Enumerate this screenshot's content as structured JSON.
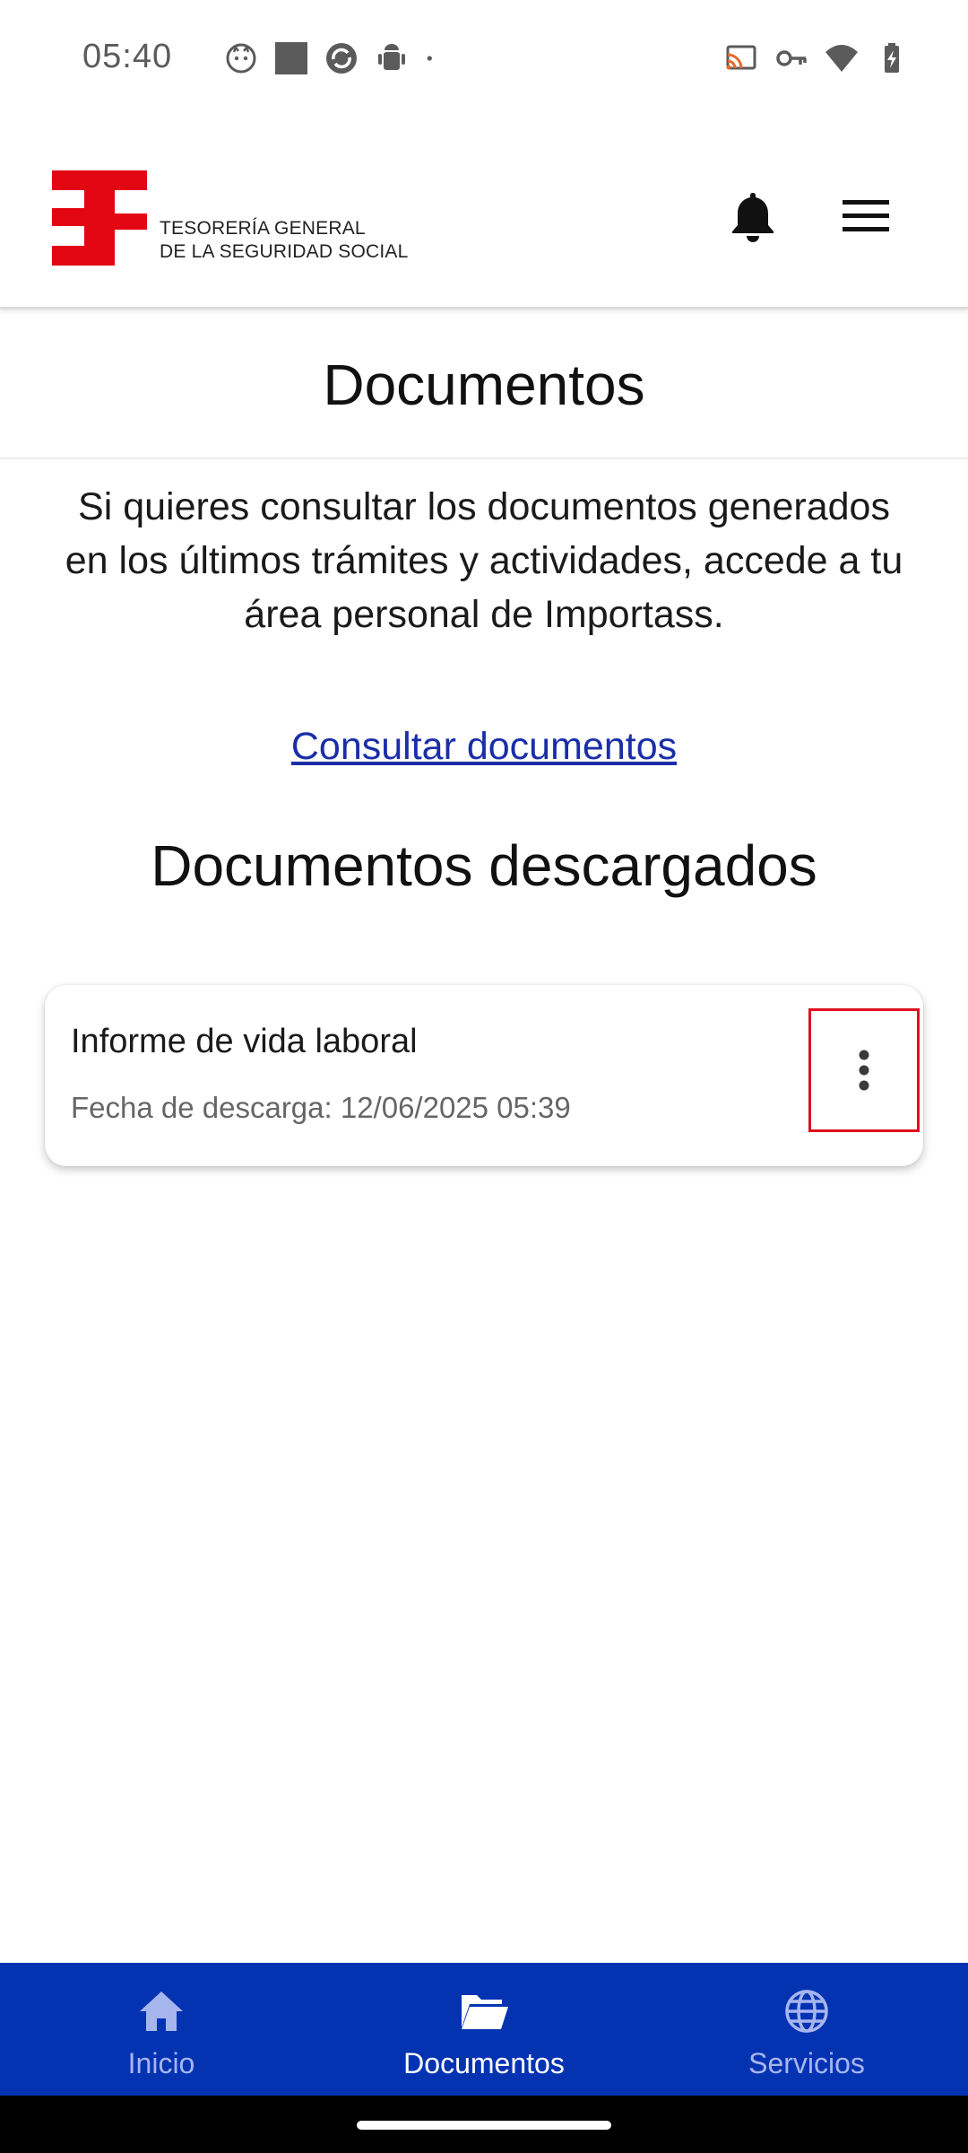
{
  "status_bar": {
    "time": "05:40",
    "left_icons": [
      "cat-notification-icon",
      "square-notification-icon",
      "sync-notification-icon",
      "android-notification-icon",
      "dot-icon"
    ],
    "right_icons": [
      "cast-icon",
      "vpn-key-icon",
      "wifi-icon",
      "battery-charging-icon"
    ]
  },
  "header": {
    "logo_line1": "TESORERÍA GENERAL",
    "logo_line2": "DE LA SEGURIDAD SOCIAL",
    "brand_color": "#e30613",
    "bell_icon": "bell-icon",
    "menu_icon": "hamburger-menu-icon"
  },
  "page": {
    "title": "Documentos",
    "intro": "Si quieres consultar los documentos generados en los últimos trámites y actividades, accede a tu área personal de Importass.",
    "consult_link": "Consultar documentos",
    "section_title": "Documentos descargados"
  },
  "documents": [
    {
      "title": "Informe de vida laboral",
      "date": "Fecha de descarga: 12/06/2025 05:39",
      "menu_icon": "more-vertical-icon"
    }
  ],
  "bottom_nav": {
    "background": "#0433b2",
    "items": [
      {
        "label": "Inicio",
        "icon": "home-icon",
        "active": false
      },
      {
        "label": "Documentos",
        "icon": "folder-icon",
        "active": true
      },
      {
        "label": "Servicios",
        "icon": "globe-icon",
        "active": false
      }
    ]
  }
}
